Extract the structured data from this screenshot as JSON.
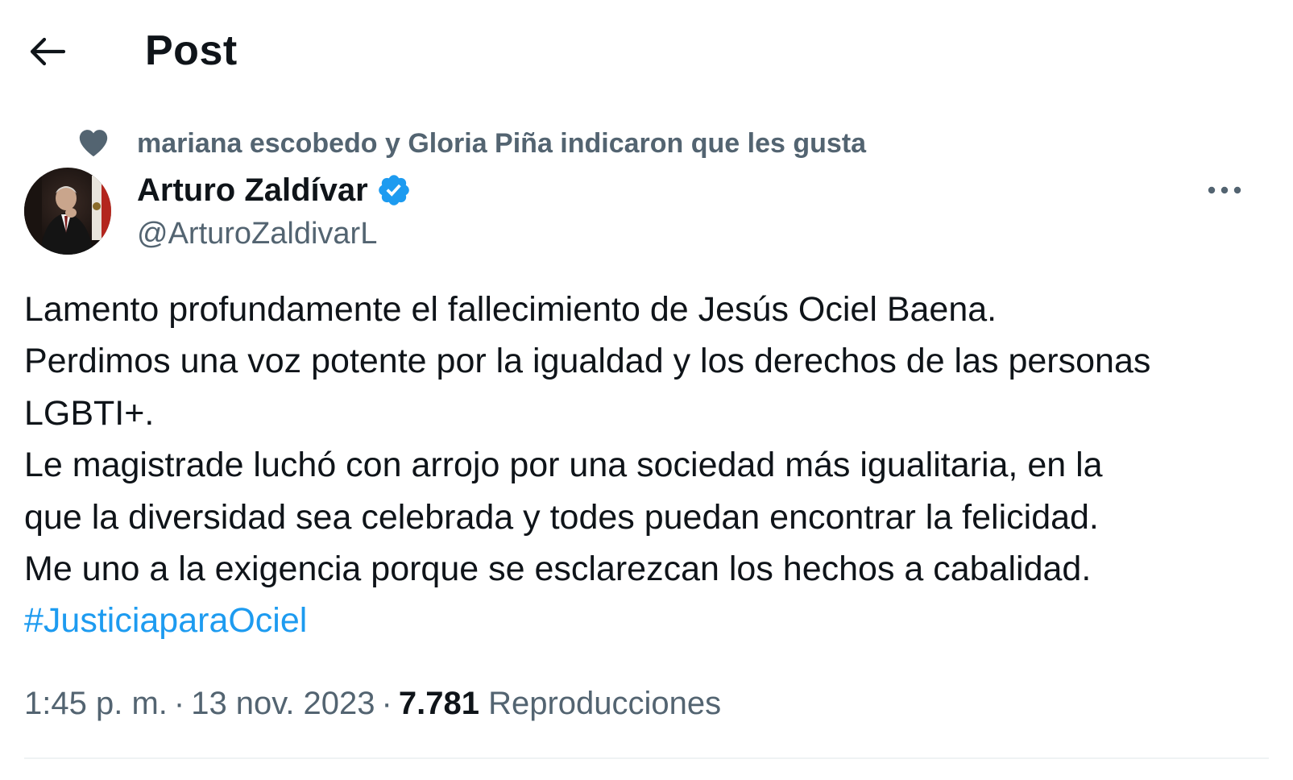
{
  "header": {
    "title": "Post",
    "back_icon": "arrow-left-icon"
  },
  "social_context": {
    "icon": "heart-icon",
    "text": "mariana escobedo y Gloria Piña indicaron que les gusta"
  },
  "author": {
    "name": "Arturo Zaldívar",
    "handle": "@ArturoZaldivarL",
    "verified": true,
    "verified_color": "#1d9bf0"
  },
  "tweet": {
    "lines": [
      "Lamento profundamente el fallecimiento de Jesús Ociel Baena.",
      "Perdimos una voz potente por la igualdad y los derechos de las personas",
      "LGBTI+.",
      "Le magistrade luchó con arrojo por una sociedad más igualitaria, en la",
      "que la diversidad sea celebrada y todes puedan encontrar la felicidad.",
      "Me uno a la exigencia porque se esclarezcan los hechos a cabalidad."
    ],
    "hashtag": "#JusticiaparaOciel",
    "hashtag_color": "#1d9bf0"
  },
  "meta": {
    "time": "1:45 p. m.",
    "separator": "·",
    "date": "13 nov. 2023",
    "views_count": "7.781",
    "views_label": "Reproducciones"
  },
  "colors": {
    "text_primary": "#0f1419",
    "text_secondary": "#536471",
    "accent": "#1d9bf0"
  }
}
